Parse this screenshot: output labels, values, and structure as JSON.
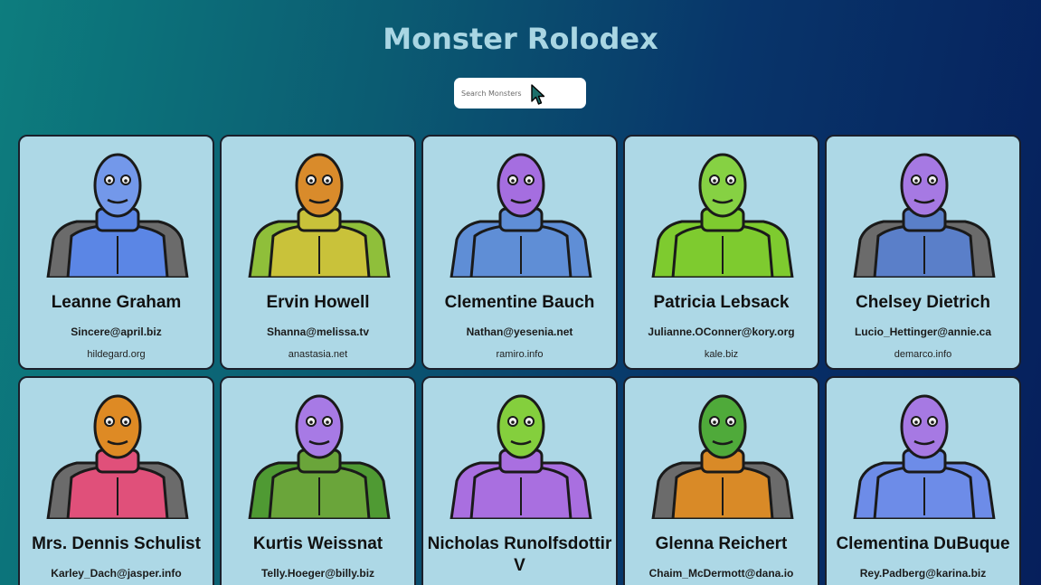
{
  "app": {
    "title": "Monster Rolodex"
  },
  "search": {
    "placeholder": "Search Monsters"
  },
  "monsters": [
    {
      "name": "Leanne Graham",
      "email": "Sincere@april.biz",
      "website": "hildegard.org",
      "body_color": "#5b86e5",
      "head_color": "#7398ea",
      "shoulder_color": "#6b6b6b",
      "icon": "blue-horned-monster-avatar"
    },
    {
      "name": "Ervin Howell",
      "email": "Shanna@melissa.tv",
      "website": "anastasia.net",
      "body_color": "#c9c23a",
      "head_color": "#d98b2b",
      "shoulder_color": "#8fbf3a",
      "icon": "orange-hooded-monster-avatar"
    },
    {
      "name": "Clementine Bauch",
      "email": "Nathan@yesenia.net",
      "website": "ramiro.info",
      "body_color": "#5f8ed6",
      "head_color": "#a56ee0",
      "shoulder_color": "#5f8ed6",
      "icon": "purple-cyclops-monster-avatar"
    },
    {
      "name": "Patricia Lebsack",
      "email": "Julianne.OConner@kory.org",
      "website": "kale.biz",
      "body_color": "#7ecb2f",
      "head_color": "#86d143",
      "shoulder_color": "#7ecb2f",
      "icon": "green-robot-helmet-monster-avatar"
    },
    {
      "name": "Chelsey Dietrich",
      "email": "Lucio_Hettinger@annie.ca",
      "website": "demarco.info",
      "body_color": "#5a7fc9",
      "head_color": "#a679e3",
      "shoulder_color": "#6b6b6b",
      "icon": "purple-visor-monster-avatar"
    },
    {
      "name": "Mrs. Dennis Schulist",
      "email": "Karley_Dach@jasper.info",
      "website": "",
      "body_color": "#e0507a",
      "head_color": "#de8a24",
      "shoulder_color": "#6b6b6b",
      "icon": "orange-antenna-monster-avatar"
    },
    {
      "name": "Kurtis Weissnat",
      "email": "Telly.Hoeger@billy.biz",
      "website": "",
      "body_color": "#6aa53a",
      "head_color": "#a77ae5",
      "shoulder_color": "#4f9a33",
      "icon": "purple-unicorn-monster-avatar"
    },
    {
      "name": "Nicholas Runolfsdottir V",
      "email": "",
      "website": "",
      "body_color": "#a96fe0",
      "head_color": "#84cf3d",
      "shoulder_color": "#a96fe0",
      "icon": "green-helmet-monster-avatar"
    },
    {
      "name": "Glenna Reichert",
      "email": "Chaim_McDermott@dana.io",
      "website": "",
      "body_color": "#d98a27",
      "head_color": "#4faa3a",
      "shoulder_color": "#6b6b6b",
      "icon": "green-horned-monster-avatar"
    },
    {
      "name": "Clementina DuBuque",
      "email": "Rey.Padberg@karina.biz",
      "website": "",
      "body_color": "#6d8ce8",
      "head_color": "#a679e3",
      "shoulder_color": "#6d8ce8",
      "icon": "purple-smiley-monster-avatar"
    }
  ]
}
